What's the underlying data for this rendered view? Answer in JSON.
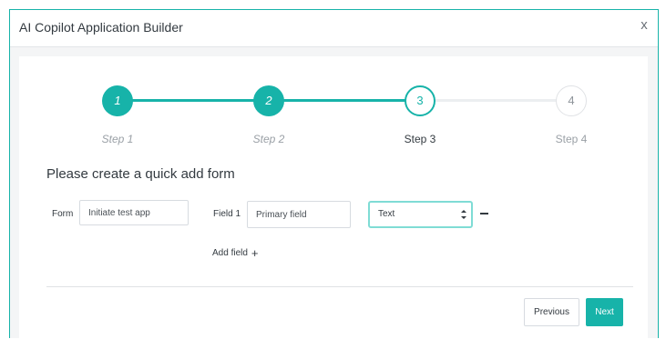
{
  "dialog": {
    "title": "AI Copilot Application Builder",
    "close_label": "x"
  },
  "stepper": {
    "current_step": 3,
    "steps": [
      {
        "number": "1",
        "label": "Step 1",
        "state": "done"
      },
      {
        "number": "2",
        "label": "Step 2",
        "state": "done"
      },
      {
        "number": "3",
        "label": "Step 3",
        "state": "current"
      },
      {
        "number": "4",
        "label": "Step 4",
        "state": "todo"
      }
    ]
  },
  "form": {
    "heading": "Please create a quick add form",
    "form_label": "Form",
    "form_value": "Initiate test app",
    "field1_label": "Field 1",
    "field1_value": "Primary field",
    "field1_type": "Text",
    "add_field_label": "Add field"
  },
  "icons": {
    "close": "close-icon",
    "plus": "plus-icon",
    "remove": "minus-icon",
    "select": "select-arrows-icon"
  },
  "footer": {
    "previous_label": "Previous",
    "next_label": "Next"
  },
  "colors": {
    "accent": "#17b3a9",
    "select_focus": "#7fdcd5"
  }
}
